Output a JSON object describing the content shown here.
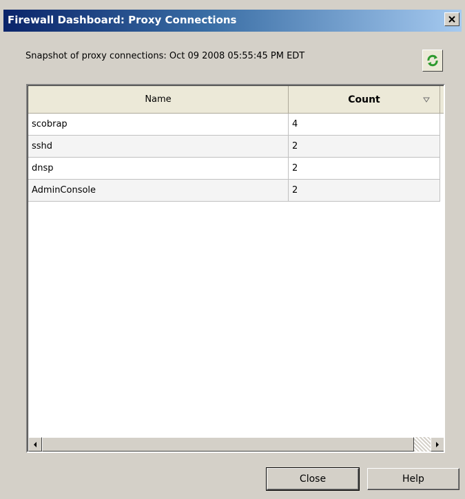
{
  "window": {
    "title": "Firewall Dashboard: Proxy Connections",
    "close_glyph": "×"
  },
  "snapshot": {
    "label": "Snapshot of proxy connections: Oct 09 2008 05:55:45 PM EDT",
    "refresh_icon": "refresh-icon"
  },
  "table": {
    "columns": [
      "Name",
      "Count"
    ],
    "sort_column": "Count",
    "sort_direction": "descending",
    "rows": [
      {
        "name": "scobrap",
        "count": "4"
      },
      {
        "name": "sshd",
        "count": "2"
      },
      {
        "name": "dnsp",
        "count": "2"
      },
      {
        "name": "AdminConsole",
        "count": "2"
      }
    ]
  },
  "buttons": {
    "close_label": "Close",
    "help_label": "Help"
  },
  "colors": {
    "titlebar_start": "#0a246a",
    "titlebar_end": "#a6caf0",
    "dialog_bg": "#d4d0c8",
    "refresh_green": "#2e9a2e"
  }
}
